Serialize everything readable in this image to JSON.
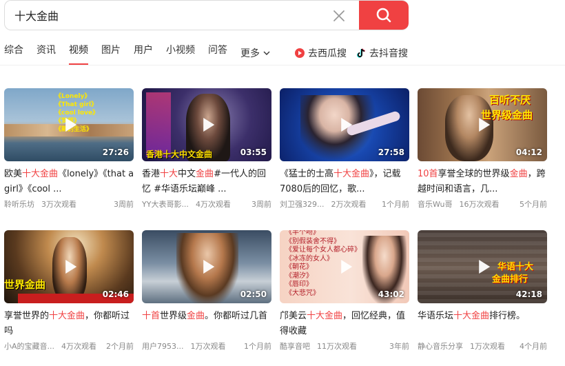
{
  "search": {
    "query": "十大金曲"
  },
  "tabs": [
    {
      "label": "综合",
      "active": false
    },
    {
      "label": "资讯",
      "active": false
    },
    {
      "label": "视频",
      "active": true
    },
    {
      "label": "图片",
      "active": false
    },
    {
      "label": "用户",
      "active": false
    },
    {
      "label": "小视频",
      "active": false
    },
    {
      "label": "问答",
      "active": false
    },
    {
      "label": "更多",
      "active": false
    }
  ],
  "ext_links": [
    {
      "label": "去西瓜搜",
      "icon": "xigua-icon"
    },
    {
      "label": "去抖音搜",
      "icon": "douyin-icon"
    }
  ],
  "colors": {
    "accent": "#f04142",
    "meta": "#888888"
  },
  "videos": [
    {
      "duration": "27:26",
      "title": [
        {
          "t": "欧美"
        },
        {
          "t": "十大金曲",
          "hl": true
        },
        {
          "t": "《lonely》《that a girl》《cool ..."
        }
      ],
      "author": "聆听乐坊",
      "views": "3万次观看",
      "time": "3周前",
      "thumb_text": [
        "《Lonely》",
        "《That girl》",
        "《cool love》",
        "《梦想》",
        "《新的生活》"
      ]
    },
    {
      "duration": "03:55",
      "title": [
        {
          "t": "香港"
        },
        {
          "t": "十大",
          "hl": true
        },
        {
          "t": "中文"
        },
        {
          "t": "金曲",
          "hl": true
        },
        {
          "t": "#一代人的回忆 #华语乐坛巅峰 ..."
        }
      ],
      "author": "YY大表哥影...",
      "views": "4万次观看",
      "time": "3周前",
      "thumb_text": [
        "香港十大中文金曲"
      ]
    },
    {
      "duration": "27:58",
      "title": [
        {
          "t": "《猛士的士高"
        },
        {
          "t": "十大金曲",
          "hl": true
        },
        {
          "t": "》，记载7080后的回忆，歌..."
        }
      ],
      "author": "刘卫强329...",
      "views": "2万次观看",
      "time": "1个月前",
      "thumb_text": []
    },
    {
      "duration": "04:12",
      "title": [
        {
          "t": "10首",
          "hl": true
        },
        {
          "t": "享誉全球的世界级"
        },
        {
          "t": "金曲",
          "hl": true
        },
        {
          "t": "，跨越时间和语言，几..."
        }
      ],
      "author": "音乐Wu哥",
      "views": "16万次观看",
      "time": "5个月前",
      "thumb_text": [
        "百听不厌",
        "世界级金曲"
      ]
    },
    {
      "duration": "02:46",
      "title": [
        {
          "t": "享誉世界的"
        },
        {
          "t": "十大金曲",
          "hl": true
        },
        {
          "t": "，你都听过吗"
        }
      ],
      "author": "小A的宝藏音...",
      "views": "4万次观看",
      "time": "2个月前",
      "thumb_text": [
        "世界金曲"
      ]
    },
    {
      "duration": "02:50",
      "title": [
        {
          "t": "十首",
          "hl": true
        },
        {
          "t": "世界级"
        },
        {
          "t": "金曲",
          "hl": true
        },
        {
          "t": "。你都听过几首"
        }
      ],
      "author": "用户7953...",
      "views": "1万次观看",
      "time": "1个月前",
      "thumb_text": []
    },
    {
      "duration": "43:02",
      "title": [
        {
          "t": "邝美云"
        },
        {
          "t": "十大金曲",
          "hl": true
        },
        {
          "t": "，回忆经典，值得收藏"
        }
      ],
      "author": "酷享音吧",
      "views": "11万次观看",
      "time": "3年前",
      "thumb_text": [
        "《半个吻》",
        "《别假装舍不得》",
        "《爱让每个女人都心碎》",
        "《冰冻的女人》",
        "《朝花》",
        "《潮汐》",
        "《唇印》",
        "《大悲咒》"
      ]
    },
    {
      "duration": "42:18",
      "title": [
        {
          "t": "华语乐坛"
        },
        {
          "t": "十大金曲",
          "hl": true
        },
        {
          "t": "排行榜。"
        }
      ],
      "author": "静心音乐分享",
      "views": "1万次观看",
      "time": "4个月前",
      "thumb_text": [
        "华语十大",
        "金曲排行"
      ]
    }
  ]
}
